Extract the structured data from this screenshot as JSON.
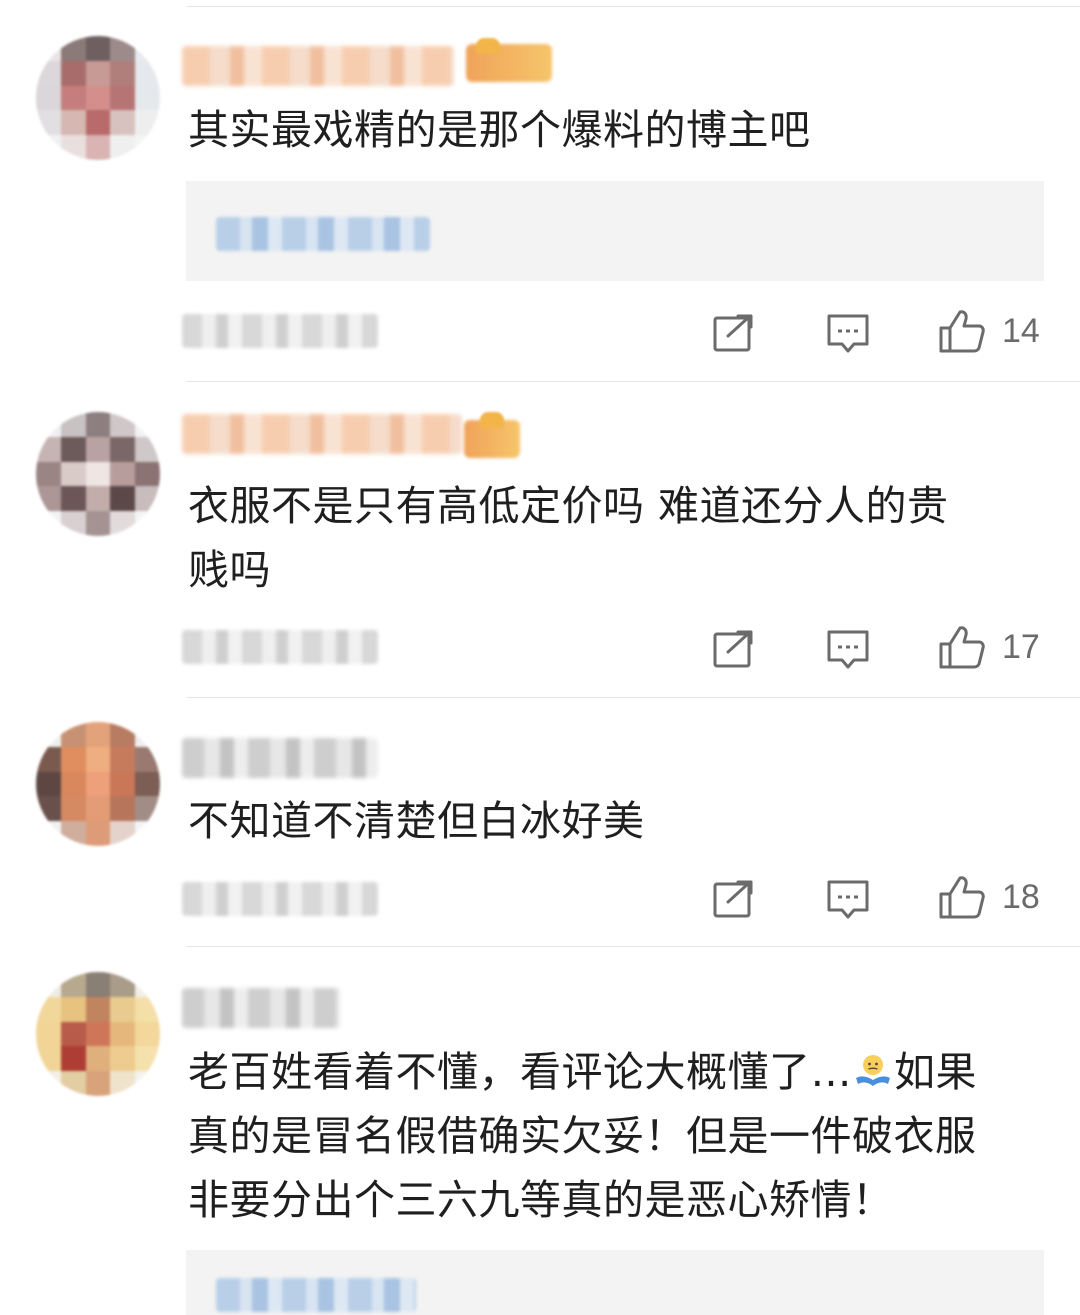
{
  "comments": [
    {
      "text": "其实最戏精的是那个爆料的博主吧",
      "likes": "14",
      "has_quote": true,
      "vip": true
    },
    {
      "text_line1": "衣服不是只有高低定价吗 难道还分人的贵",
      "text_line2": "贱吗",
      "likes": "17",
      "vip": true
    },
    {
      "text": "不知道不清楚但白冰好美",
      "likes": "18",
      "vip": false
    },
    {
      "text_line1_a": "老百姓看着不懂，看评论大概懂了…",
      "text_line1_b": "如果",
      "text_line2": "真的是冒名假借确实欠妥！但是一件破衣服",
      "text_line3": "非要分出个三六九等真的是恶心矫情！",
      "emoji": "shrug-emoji",
      "has_quote": true,
      "vip": false
    }
  ],
  "colors": {
    "text": "#1f1f1f",
    "meta": "#6b6b6b",
    "quote_bg": "#f3f3f3",
    "divider": "#e6e6e6"
  },
  "icons": [
    "repost-icon",
    "comment-icon",
    "like-icon"
  ]
}
